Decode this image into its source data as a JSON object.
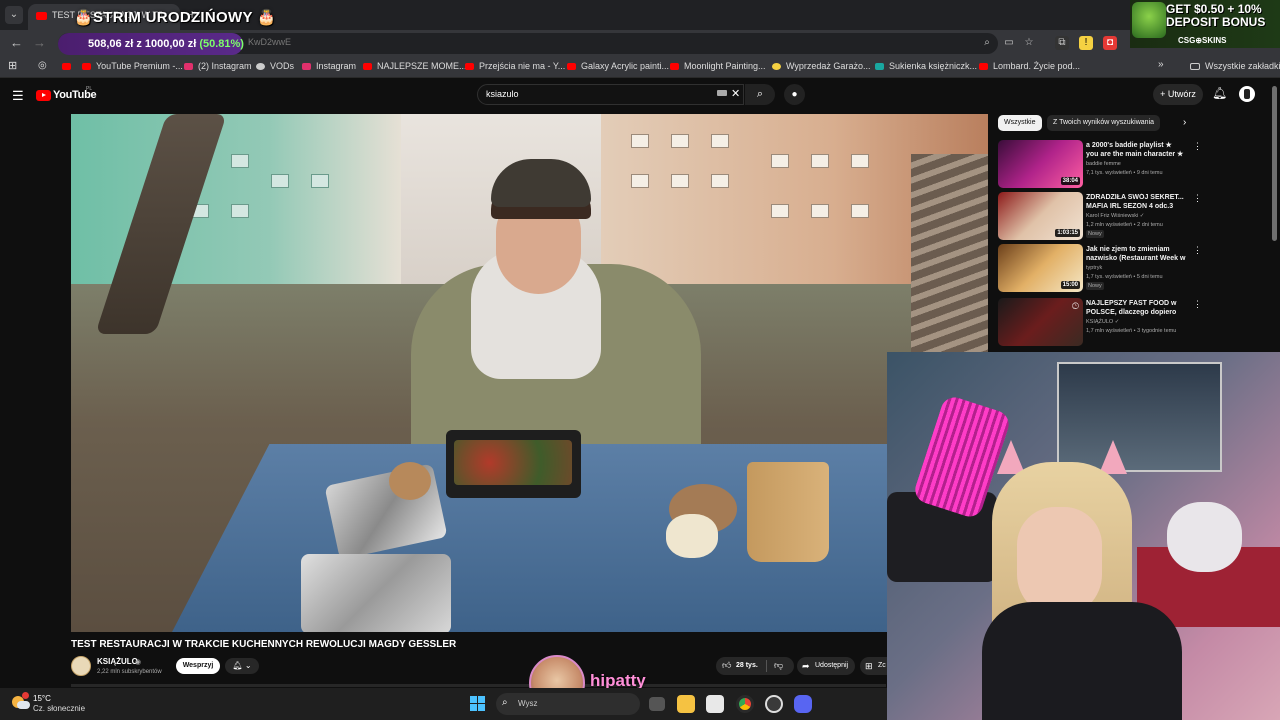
{
  "browser": {
    "tab_title": "TEST RESTAURACJI W TRA",
    "stream_overlay_title": "🎂STRIM URODZIŃOWY 🎂",
    "donation_amount": "508,06 zł z 1000,00 zł",
    "donation_pct": "(50.81%)",
    "url_fragment": "KwD2wwE",
    "bookmarks": [
      {
        "label": "YouTube Premium -...",
        "color": "#ff0000"
      },
      {
        "label": "(2) Instagram",
        "color": "#e1306c"
      },
      {
        "label": "VODs",
        "color": "#cccccc"
      },
      {
        "label": "Instagram",
        "color": "#e1306c"
      },
      {
        "label": "NAJLEPSZE MOME...",
        "color": "#ff0000"
      },
      {
        "label": "Przejścia nie ma - Y...",
        "color": "#ff0000"
      },
      {
        "label": "Galaxy Acrylic painti...",
        "color": "#ff0000"
      },
      {
        "label": "Moonlight Painting...",
        "color": "#ff0000"
      },
      {
        "label": "Wyprzedaż Garażo...",
        "color": "#f5d142"
      },
      {
        "label": "Sukienka księżniczk...",
        "color": "#19a7a0"
      },
      {
        "label": "Lombard. Życie pod...",
        "color": "#ff0000"
      }
    ],
    "all_bookmarks": "Wszystkie zakładki"
  },
  "ad": {
    "line1": "GET $0.50 + 10%",
    "line2": "DEPOSIT BONUS",
    "brand": "CSG⊕SKINS"
  },
  "youtube": {
    "logo": "YouTube",
    "region": "PL",
    "search_query": "ksiazulo",
    "create_label": "Utwórz",
    "video": {
      "title": "TEST RESTAURACJI W TRAKCIE KUCHENNYCH REWOLUCJI MAGDY GESSLER",
      "channel": "KSIĄŻULO",
      "subscribers": "2,22 mln subskrybentów",
      "support_label": "Wesprzyj",
      "likes": "28 tys.",
      "share_label": "Udostępnij",
      "save_label": "Zc"
    },
    "chips": [
      {
        "label": "Wszystkie",
        "active": true
      },
      {
        "label": "Z Twoich wyników wyszukiwania",
        "active": false
      }
    ],
    "recommendations": [
      {
        "title": "a 2000's baddie playlist ★ you are the main character ★",
        "channel": "baddie femme",
        "meta": "7,1 tys. wyświetleń • 9 dni temu",
        "duration": "38:04",
        "badge": "",
        "thumb": "linear-gradient(135deg,#3a0d3a,#b0238a 50%,#ff5fa2)"
      },
      {
        "title": "ZDRADZIŁA SWÓJ SEKRET... MAFIA IRL SEZON 4 odc.3",
        "channel": "Karol Friz Wiśniewski ✓",
        "meta": "1,2 mln wyświetleń • 2 dni temu",
        "duration": "1:03:15",
        "badge": "Nowy",
        "thumb": "linear-gradient(135deg,#8c1a1a,#e0c2a8 50%,#f1e2d2)"
      },
      {
        "title": "Jak nie zjem to zmieniam nazwisko (Restaurant Week w ...",
        "channel": "typtryk",
        "meta": "1,7 tys. wyświetleń • 5 dni temu",
        "duration": "15:00",
        "badge": "Nowy",
        "thumb": "linear-gradient(135deg,#6b3f1a,#e2b066 50%,#f5e7c6)"
      },
      {
        "title": "NAJLEPSZY FAST FOOD w POLSCE, dlaczego dopiero ter...",
        "channel": "KSIĄŻULO ✓",
        "meta": "1,7 mln wyświetleń • 3 tygodnie temu",
        "duration": "",
        "badge": "",
        "thumb": "linear-gradient(135deg,#1a1a1a,#6b1d1d 50%,#3a2a22)"
      }
    ]
  },
  "overlay": {
    "username": "hipatty"
  },
  "taskbar": {
    "temperature": "15°C",
    "weather": "Cz. słonecznie",
    "search_placeholder": "Wysz"
  }
}
